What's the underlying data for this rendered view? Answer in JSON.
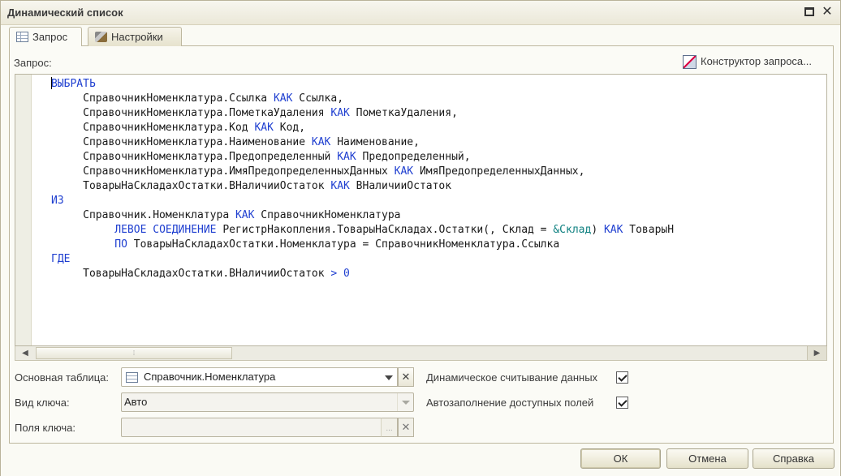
{
  "window": {
    "title": "Динамический список"
  },
  "tabs": [
    {
      "label": "Запрос",
      "icon": "table-icon",
      "active": true
    },
    {
      "label": "Настройки",
      "icon": "settings-tools-icon",
      "active": false
    }
  ],
  "query": {
    "label": "Запрос:",
    "constructor_label": "Конструктор запроса..."
  },
  "code_lines": [
    [
      {
        "t": "ВЫБРАТЬ",
        "c": "kw"
      }
    ],
    [
      {
        "t": "     СправочникНоменклатура.Ссылка "
      },
      {
        "t": "КАК",
        "c": "kw"
      },
      {
        "t": " Ссылка,"
      }
    ],
    [
      {
        "t": "     СправочникНоменклатура.ПометкаУдаления "
      },
      {
        "t": "КАК",
        "c": "kw"
      },
      {
        "t": " ПометкаУдаления,"
      }
    ],
    [
      {
        "t": "     СправочникНоменклатура.Код "
      },
      {
        "t": "КАК",
        "c": "kw"
      },
      {
        "t": " Код,"
      }
    ],
    [
      {
        "t": "     СправочникНоменклатура.Наименование "
      },
      {
        "t": "КАК",
        "c": "kw"
      },
      {
        "t": " Наименование,"
      }
    ],
    [
      {
        "t": "     СправочникНоменклатура.Предопределенный "
      },
      {
        "t": "КАК",
        "c": "kw"
      },
      {
        "t": " Предопределенный,"
      }
    ],
    [
      {
        "t": "     СправочникНоменклатура.ИмяПредопределенныхДанных "
      },
      {
        "t": "КАК",
        "c": "kw"
      },
      {
        "t": " ИмяПредопределенныхДанных,"
      }
    ],
    [
      {
        "t": "     ТоварыНаСкладахОстатки.ВНаличииОстаток "
      },
      {
        "t": "КАК",
        "c": "kw"
      },
      {
        "t": " ВНаличииОстаток"
      }
    ],
    [
      {
        "t": "ИЗ",
        "c": "kw"
      }
    ],
    [
      {
        "t": "     Справочник.Номенклатура "
      },
      {
        "t": "КАК",
        "c": "kw"
      },
      {
        "t": " СправочникНоменклатура"
      }
    ],
    [
      {
        "t": "          "
      },
      {
        "t": "ЛЕВОЕ СОЕДИНЕНИЕ",
        "c": "kw"
      },
      {
        "t": " РегистрНакопления.ТоварыНаСкладах.Остатки(, Склад = "
      },
      {
        "t": "&Склад",
        "c": "pm"
      },
      {
        "t": ") "
      },
      {
        "t": "КАК",
        "c": "kw"
      },
      {
        "t": " ТоварыН"
      }
    ],
    [
      {
        "t": "          "
      },
      {
        "t": "ПО",
        "c": "kw"
      },
      {
        "t": " ТоварыНаСкладахОстатки.Номенклатура = СправочникНоменклатура.Ссылка"
      }
    ],
    [
      {
        "t": "ГДЕ",
        "c": "kw"
      }
    ],
    [
      {
        "t": "     ТоварыНаСкладахОстатки.ВНаличииОстаток "
      },
      {
        "t": ">",
        "c": "kw"
      },
      {
        "t": " "
      },
      {
        "t": "0",
        "c": "num"
      }
    ]
  ],
  "form": {
    "main_table_label": "Основная таблица:",
    "main_table_value": "Справочник.Номенклатура",
    "key_type_label": "Вид ключа:",
    "key_type_value": "Авто",
    "key_fields_label": "Поля ключа:",
    "key_fields_value": "",
    "dots": "...",
    "dynamic_read_label": "Динамическое считывание данных",
    "dynamic_read_checked": true,
    "autofill_label": "Автозаполнение доступных полей",
    "autofill_checked": true
  },
  "buttons": {
    "ok": "ОК",
    "cancel": "Отмена",
    "help": "Справка"
  }
}
